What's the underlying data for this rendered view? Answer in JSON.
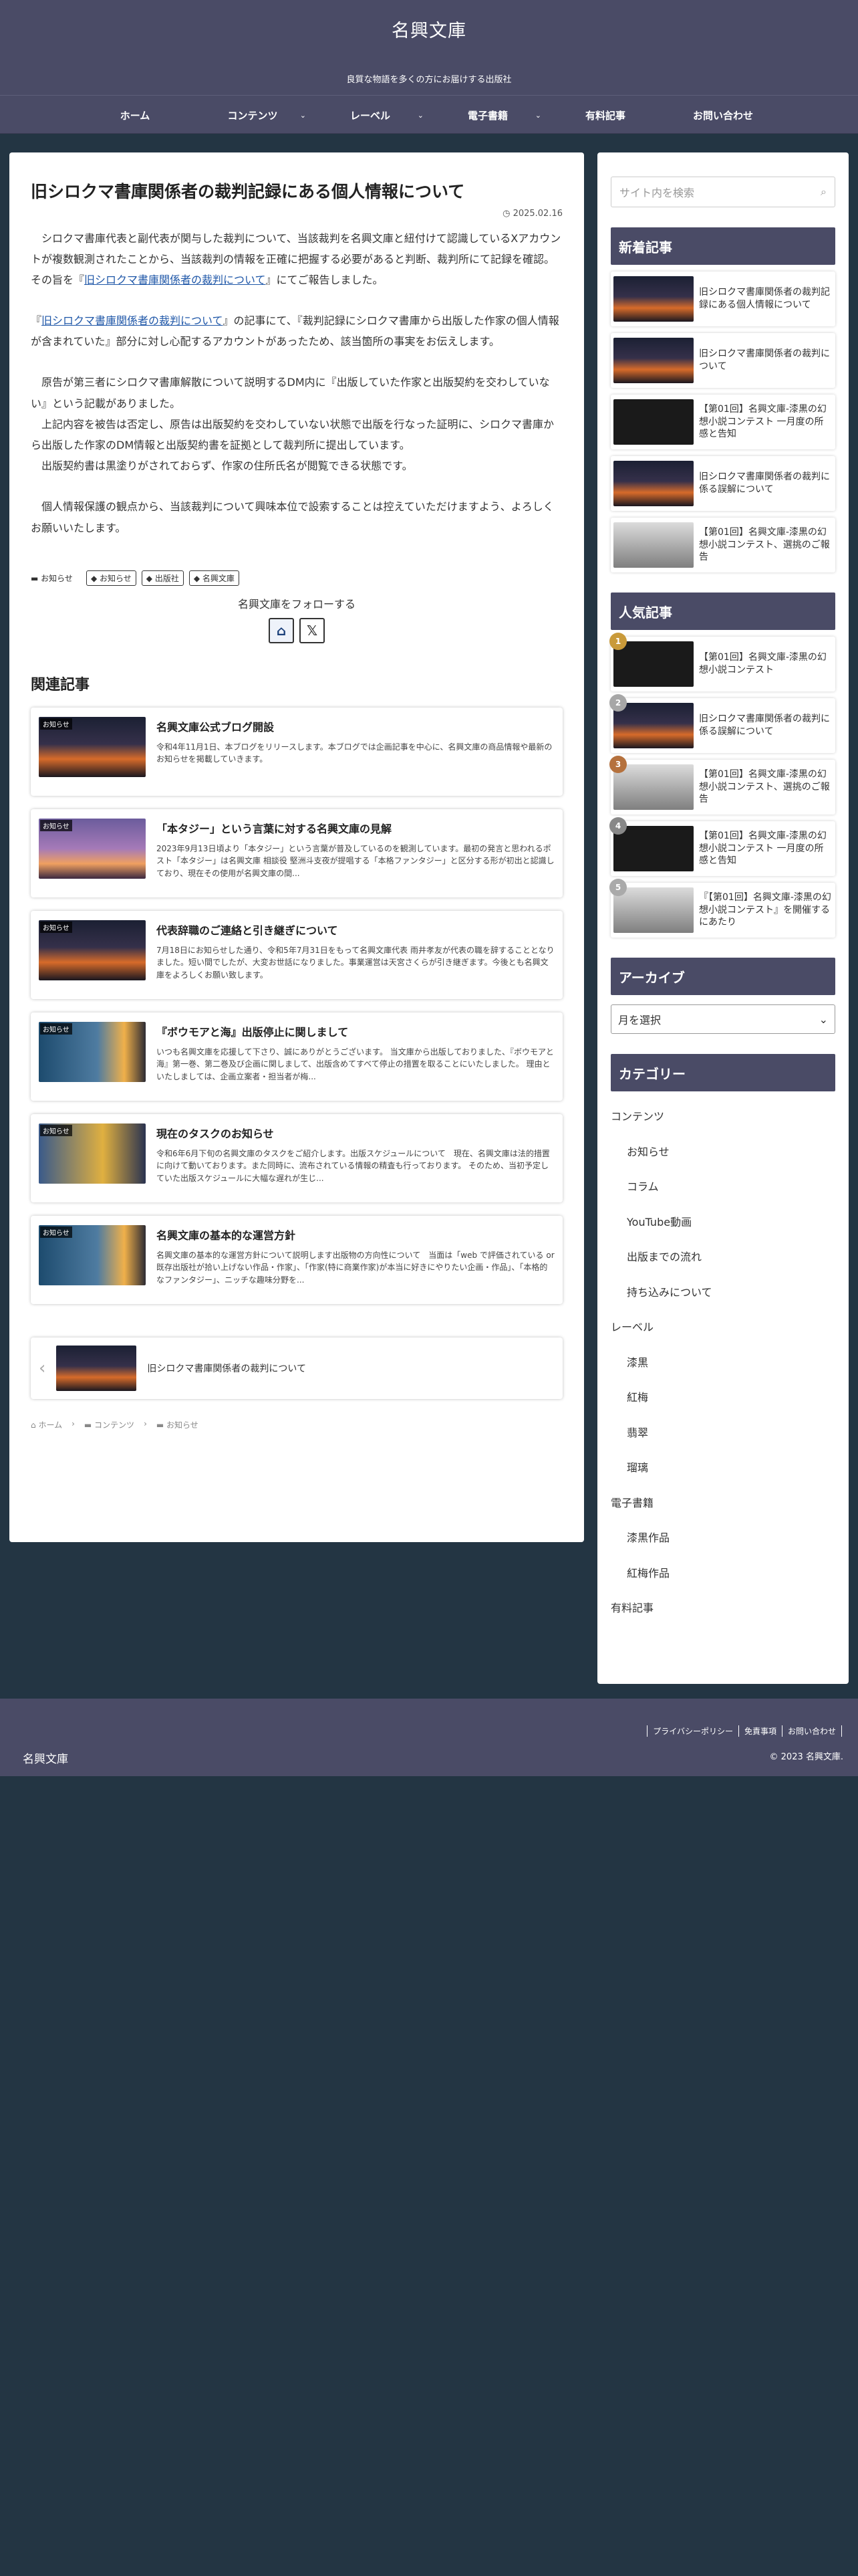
{
  "header": {
    "site_title": "名興文庫",
    "tagline": "良質な物語を多くの方にお届けする出版社"
  },
  "nav": [
    {
      "label": "ホーム"
    },
    {
      "label": "コンテンツ"
    },
    {
      "label": "レーベル"
    },
    {
      "label": "電子書籍"
    },
    {
      "label": "有料記事"
    },
    {
      "label": "お問い合わせ"
    }
  ],
  "article": {
    "title": "旧シロクマ書庫関係者の裁判記録にある個人情報について",
    "date": "2025.02.16",
    "paragraphs": {
      "p1": "　シロクマ書庫代表と副代表が関与した裁判について、当該裁判を名興文庫と紐付けて認識しているXアカウントが複数観測されたことから、当該裁判の情報を正確に把握する必要があると判断、裁判所にて記録を確認。その旨を『",
      "p1_link": "旧シロクマ書庫関係者の裁判について",
      "p1_end": "』にてご報告しました。",
      "p2_start": "『",
      "p2_link": "旧シロクマ書庫関係者の裁判について",
      "p2_end": "』の記事にて、『裁判記録にシロクマ書庫から出版した作家の個人情報が含まれていた』部分に対し心配するアカウントがあったため、該当箇所の事実をお伝えします。",
      "p3": "　原告が第三者にシロクマ書庫解散について説明するDM内に『出版していた作家と出版契約を交わしていない』という記載がありました。\n　上記内容を被告は否定し、原告は出版契約を交わしていない状態で出版を行なった証明に、シロクマ書庫から出版した作家のDM情報と出版契約書を証拠として裁判所に提出しています。\n　出版契約書は黒塗りがされておらず、作家の住所氏名が閲覧できる状態です。",
      "p4": "　個人情報保護の観点から、当該裁判について興味本位で設索することは控えていただけますよう、よろしくお願いいたします。"
    },
    "category": "お知らせ",
    "tags": [
      "お知らせ",
      "出版社",
      "名興文庫"
    ],
    "follow_label": "名興文庫をフォローする"
  },
  "related": {
    "heading": "関連記事",
    "items": [
      {
        "label": "お知らせ",
        "title": "名興文庫公式ブログ開設",
        "text": "令和4年11月1日、本ブログをリリースします。本ブログでは企画記事を中心に、名興文庫の商品情報や最新のお知らせを掲載していきます。"
      },
      {
        "label": "お知らせ",
        "title": "「本タジー」という言葉に対する名興文庫の見解",
        "text": "2023年9月13日頃より「本タジー」という言葉が普及しているのを観測しています。最初の発言と思われるポスト「本タジー」は名興文庫 相談役 堅洲斗支夜が提唱する「本格ファンタジー」と区分する形が初出と認識しており、現在その使用が名興文庫の間..."
      },
      {
        "label": "お知らせ",
        "title": "代表辞職のご連絡と引き継ぎについて",
        "text": "7月18日にお知らせした通り、令和5年7月31日をもって名興文庫代表 雨井孝友が代表の職を辞することとなりました。短い間でしたが、大変お世話になりました。事業運営は天宮さくらが引き継ぎます。今後とも名興文庫をよろしくお願い致します。"
      },
      {
        "label": "お知らせ",
        "title": "『ボウモアと海』出版停止に関しまして",
        "text": "いつも名興文庫を応援して下さり、誠にありがとうございます。 当文庫から出版しておりました、『ボウモアと海』第一巻、第二巻及び企画に関しまして、出版含めてすべて停止の措置を取ることにいたしました。 理由といたしましては、企画立案者・担当者が梅..."
      },
      {
        "label": "お知らせ",
        "title": "現在のタスクのお知らせ",
        "text": "令和6年6月下旬の名興文庫のタスクをご紹介します。出版スケジュールについて　現在、名興文庫は法的措置に向けて動いております。また同時に、流布されている情報の精査も行っております。 そのため、当初予定していた出版スケジュールに大幅な遅れが生じ..."
      },
      {
        "label": "お知らせ",
        "title": "名興文庫の基本的な運営方針",
        "text": "名興文庫の基本的な運営方針について説明します出版物の方向性について　当面は「web で評価されている or 既存出版社が拾い上げない作品・作家」、「作家(特に商業作家)が本当に好きにやりたい企画・作品」、「本格的なファンタジー」、ニッチな趣味分野を..."
      }
    ]
  },
  "pager": {
    "title": "旧シロクマ書庫関係者の裁判について"
  },
  "breadcrumb": [
    "ホーム",
    "コンテンツ",
    "お知らせ"
  ],
  "sidebar": {
    "search_placeholder": "サイト内を検索",
    "new_title": "新着記事",
    "new_items": [
      "旧シロクマ書庫関係者の裁判記録にある個人情報について",
      "旧シロクマ書庫関係者の裁判について",
      "【第01回】名興文庫-漆黒の幻想小説コンテスト 一月度の所感と告知",
      "旧シロクマ書庫関係者の裁判に係る誤解について",
      "【第01回】名興文庫-漆黒の幻想小説コンテスト、選挑のご報告"
    ],
    "popular_title": "人気記事",
    "popular_items": [
      {
        "rank": "1",
        "title": "【第01回】名興文庫-漆黒の幻想小説コンテスト"
      },
      {
        "rank": "2",
        "title": "旧シロクマ書庫関係者の裁判に係る誤解について"
      },
      {
        "rank": "3",
        "title": "【第01回】名興文庫-漆黒の幻想小説コンテスト、選挑のご報告"
      },
      {
        "rank": "4",
        "title": "【第01回】名興文庫-漆黒の幻想小説コンテスト 一月度の所感と告知"
      },
      {
        "rank": "5",
        "title": "『【第01回】名興文庫-漆黒の幻想小説コンテスト』を開催するにあたり"
      }
    ],
    "archive_title": "アーカイブ",
    "archive_select": "月を選択",
    "category_title": "カテゴリー",
    "categories": [
      {
        "label": "コンテンツ",
        "indent": false
      },
      {
        "label": "お知らせ",
        "indent": true
      },
      {
        "label": "コラム",
        "indent": true
      },
      {
        "label": "YouTube動画",
        "indent": true
      },
      {
        "label": "出版までの流れ",
        "indent": true
      },
      {
        "label": "持ち込みについて",
        "indent": true
      },
      {
        "label": "レーベル",
        "indent": false
      },
      {
        "label": "漆黒",
        "indent": true
      },
      {
        "label": "紅梅",
        "indent": true
      },
      {
        "label": "翡翠",
        "indent": true
      },
      {
        "label": "瑠璃",
        "indent": true
      },
      {
        "label": "電子書籍",
        "indent": false
      },
      {
        "label": "漆黒作品",
        "indent": true
      },
      {
        "label": "紅梅作品",
        "indent": true
      },
      {
        "label": "有料記事",
        "indent": false
      }
    ]
  },
  "footer": {
    "links": [
      "プライバシーポリシー",
      "免責事項",
      "お問い合わせ"
    ],
    "logo": "名興文庫",
    "copyright": "© 2023 名興文庫."
  },
  "colors": {
    "header_bg": "#4a4b66",
    "page_bg": "#233543",
    "link": "#1f57a8",
    "rank1": "#c99a3a",
    "rank2": "#a7a7a7",
    "rank3": "#b5713d",
    "rank4": "#888888",
    "rank5": "#aaaaaa"
  }
}
